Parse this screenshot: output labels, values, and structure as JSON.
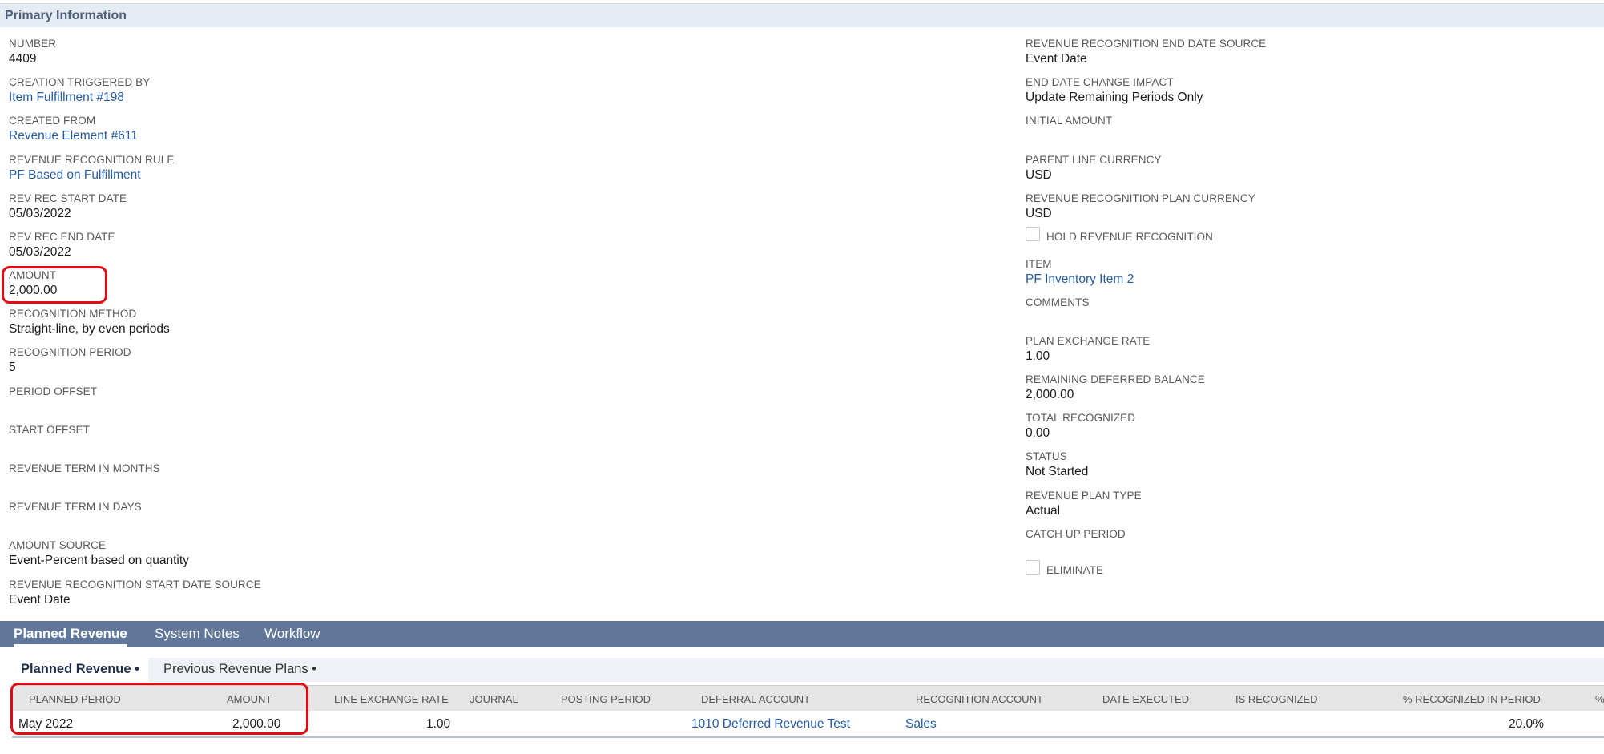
{
  "section": {
    "title": "Primary Information"
  },
  "left_fields": [
    {
      "label": "NUMBER",
      "value": "4409",
      "link": false
    },
    {
      "label": "CREATION TRIGGERED BY",
      "value": "Item Fulfillment #198",
      "link": true
    },
    {
      "label": "CREATED FROM",
      "value": "Revenue Element #611",
      "link": true
    },
    {
      "label": "REVENUE RECOGNITION RULE",
      "value": "PF Based on Fulfillment",
      "link": true
    },
    {
      "label": "REV REC START DATE",
      "value": "05/03/2022",
      "link": false
    },
    {
      "label": "REV REC END DATE",
      "value": "05/03/2022",
      "link": false
    },
    {
      "label": "AMOUNT",
      "value": "2,000.00",
      "link": false
    },
    {
      "label": "RECOGNITION METHOD",
      "value": "Straight-line, by even periods",
      "link": false
    },
    {
      "label": "RECOGNITION PERIOD",
      "value": "5",
      "link": false
    },
    {
      "label": "PERIOD OFFSET",
      "value": "",
      "link": false
    },
    {
      "label": "START OFFSET",
      "value": "",
      "link": false
    },
    {
      "label": "REVENUE TERM IN MONTHS",
      "value": "",
      "link": false
    },
    {
      "label": "REVENUE TERM IN DAYS",
      "value": "",
      "link": false
    },
    {
      "label": "AMOUNT SOURCE",
      "value": "Event-Percent based on quantity",
      "link": false
    },
    {
      "label": "REVENUE RECOGNITION START DATE SOURCE",
      "value": "Event Date",
      "link": false
    }
  ],
  "right_fields": [
    {
      "label": "REVENUE RECOGNITION END DATE SOURCE",
      "value": "Event Date",
      "link": false
    },
    {
      "label": "END DATE CHANGE IMPACT",
      "value": "Update Remaining Periods Only",
      "link": false
    },
    {
      "label": "INITIAL AMOUNT",
      "value": "",
      "link": false
    },
    {
      "label": "PARENT LINE CURRENCY",
      "value": "USD",
      "link": false
    },
    {
      "label": "REVENUE RECOGNITION PLAN CURRENCY",
      "value": "USD",
      "link": false
    },
    {
      "label": "HOLD REVENUE RECOGNITION",
      "checkbox": true,
      "checked": false
    },
    {
      "label": "ITEM",
      "value": "PF Inventory Item 2",
      "link": true
    },
    {
      "label": "COMMENTS",
      "value": "",
      "link": false
    },
    {
      "label": "PLAN EXCHANGE RATE",
      "value": "1.00",
      "link": false
    },
    {
      "label": "REMAINING DEFERRED BALANCE",
      "value": "2,000.00",
      "link": false
    },
    {
      "label": "TOTAL RECOGNIZED",
      "value": "0.00",
      "link": false
    },
    {
      "label": "STATUS",
      "value": "Not Started",
      "link": false
    },
    {
      "label": "REVENUE PLAN TYPE",
      "value": "Actual",
      "link": false
    },
    {
      "label": "CATCH UP PERIOD",
      "value": "",
      "link": false
    },
    {
      "label": "ELIMINATE",
      "checkbox": true,
      "checked": false
    }
  ],
  "tabs": [
    {
      "label": "Planned Revenue",
      "active": true
    },
    {
      "label": "System Notes",
      "active": false
    },
    {
      "label": "Workflow",
      "active": false
    }
  ],
  "subtabs": [
    {
      "label": "Planned Revenue •",
      "active": true
    },
    {
      "label": "Previous Revenue Plans •",
      "active": false
    }
  ],
  "table": {
    "headers": [
      "PLANNED PERIOD",
      "AMOUNT",
      "LINE EXCHANGE RATE",
      "JOURNAL",
      "POSTING PERIOD",
      "DEFERRAL ACCOUNT",
      "RECOGNITION ACCOUNT",
      "DATE EXECUTED",
      "IS RECOGNIZED",
      "% RECOGNIZED IN PERIOD",
      "%"
    ],
    "rows": [
      [
        "May 2022",
        "2,000.00",
        "1.00",
        "",
        "",
        "1010 Deferred Revenue Test",
        "Sales",
        "",
        "",
        "20.0%",
        ""
      ]
    ]
  },
  "colors": {
    "highlight": "#e50914",
    "link": "#255ba4",
    "tabbar": "#607799"
  }
}
